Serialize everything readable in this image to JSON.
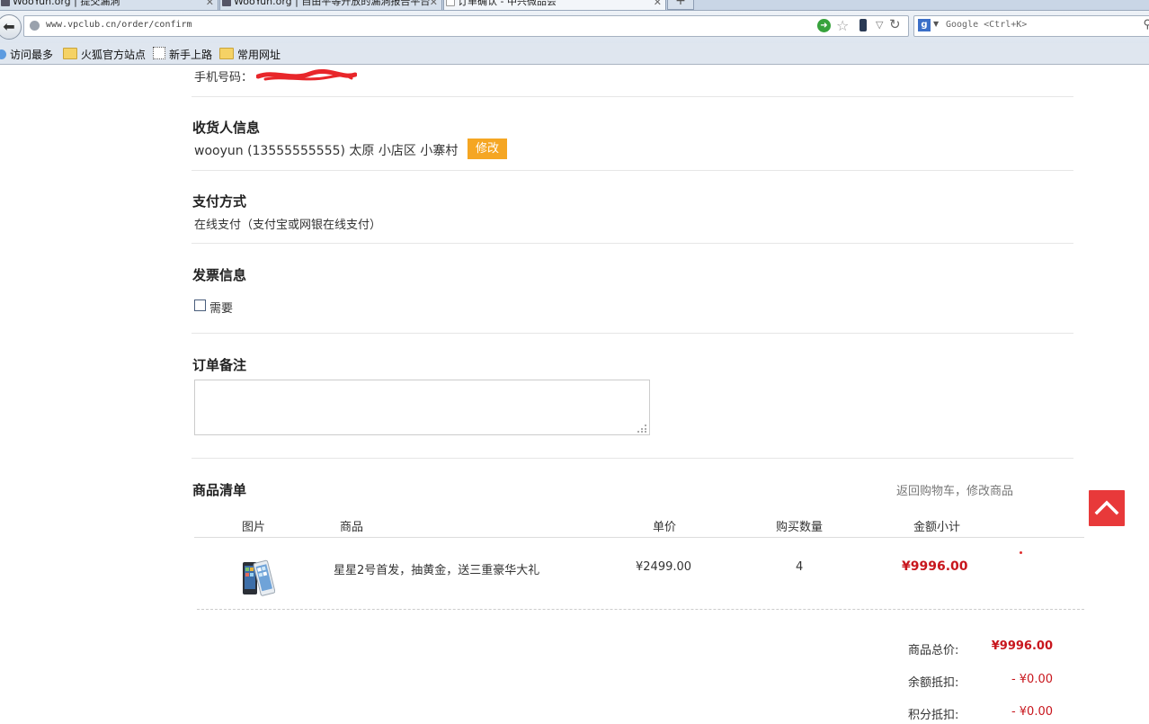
{
  "browser": {
    "tabs": [
      {
        "title": "WooYun.org | 提交漏洞",
        "active": false
      },
      {
        "title": "WooYun.org | 自由平等开放的漏洞报告平台",
        "active": false
      },
      {
        "title": "订单确认 - 中兴微品会",
        "active": true
      }
    ],
    "new_tab_icon": "+",
    "url": "www.vpclub.cn/order/confirm",
    "search_placeholder": "Google <Ctrl+K>",
    "bookmarks": [
      "访问最多",
      "火狐官方站点",
      "新手上路",
      "常用网址"
    ]
  },
  "buyer": {
    "phone_label": "手机号码："
  },
  "receiver": {
    "title": "收货人信息",
    "info": "wooyun (13555555555) 太原 小店区 小寨村",
    "edit_label": "修改"
  },
  "payment": {
    "title": "支付方式",
    "method": "在线支付（支付宝或网银在线支付）"
  },
  "invoice": {
    "title": "发票信息",
    "need_label": "需要",
    "checked": false
  },
  "remark": {
    "title": "订单备注",
    "value": ""
  },
  "goods": {
    "title": "商品清单",
    "back_to_cart": "返回购物车，修改商品",
    "columns": [
      "图片",
      "商品",
      "单价",
      "购买数量",
      "金额小计"
    ],
    "rows": [
      {
        "name": "星星2号首发，抽黄金，送三重豪华大礼",
        "price": "¥2499.00",
        "qty": "4",
        "subtotal": "¥9996.00"
      }
    ]
  },
  "summary": {
    "total_label": "商品总价:",
    "total_value": "¥9996.00",
    "balance_label": "余额抵扣:",
    "balance_value": "- ¥0.00",
    "points_label": "积分抵扣:",
    "points_value": "- ¥0.00"
  },
  "colors": {
    "accent_orange": "#f5a623",
    "price_red": "#c8161d",
    "scroll_top_red": "#e8393a"
  }
}
